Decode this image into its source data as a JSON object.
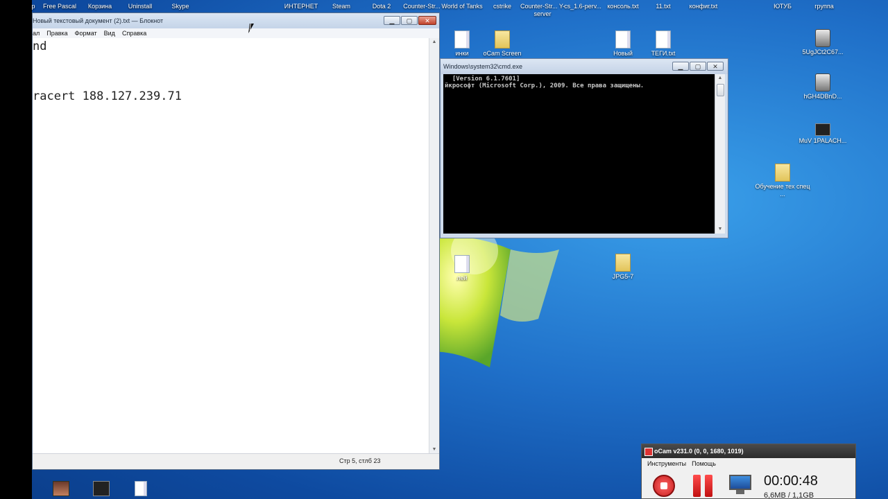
{
  "desktop": {
    "icons_top": [
      {
        "label": "р",
        "kind": "app"
      },
      {
        "label": "Free Pascal",
        "kind": "app"
      },
      {
        "label": "Корзина",
        "kind": "app"
      },
      {
        "label": "Uninstall",
        "kind": "app"
      },
      {
        "label": "Skype",
        "kind": "app"
      },
      {
        "label": "ИНТЕРНЕТ",
        "kind": "app"
      },
      {
        "label": "Steam",
        "kind": "app"
      },
      {
        "label": "Dota 2",
        "kind": "app"
      },
      {
        "label": "Counter-Str...",
        "kind": "app"
      },
      {
        "label": "World of Tanks",
        "kind": "app"
      },
      {
        "label": "cstrike",
        "kind": "folder"
      },
      {
        "label": "Counter-Str... Y-server",
        "kind": "app"
      },
      {
        "label": "cs_1.6-perv...",
        "kind": "doc"
      },
      {
        "label": "консоль.txt",
        "kind": "doc"
      },
      {
        "label": "11.txt",
        "kind": "doc"
      },
      {
        "label": "конфиг.txt",
        "kind": "doc"
      },
      {
        "label": "ЮТУБ",
        "kind": "app"
      },
      {
        "label": "группа",
        "kind": "app"
      }
    ],
    "icons_other": [
      {
        "label": "инки",
        "kind": "doc"
      },
      {
        "label": "oCam Screen",
        "kind": "folder"
      },
      {
        "label": "Новый",
        "kind": "doc"
      },
      {
        "label": "ТЕГИ.txt",
        "kind": "doc"
      },
      {
        "label": "5UgJCt2C67...",
        "kind": "app"
      },
      {
        "label": "hGH4DBnD...",
        "kind": "app"
      },
      {
        "label": "MuV 1PALACH...",
        "kind": "dark"
      },
      {
        "label": "Обучение тех спец ...",
        "kind": "folder"
      },
      {
        "label": "лей",
        "kind": "doc"
      },
      {
        "label": "JPG5-7",
        "kind": "folder"
      }
    ]
  },
  "notepad": {
    "title": "Новый текстовый документ (2).txt — Блокнот",
    "menu": [
      "ал",
      "Правка",
      "Формат",
      "Вид",
      "Справка"
    ],
    "lines": [
      "nd",
      "racert 188.127.239.71"
    ],
    "status": "Стр 5, стлб 23",
    "btn_min": "▁",
    "btn_max": "▢",
    "btn_close": "✕"
  },
  "cmd": {
    "title": "Windows\\system32\\cmd.exe",
    "lines": [
      "  [Version 6.1.7601]",
      "йкрософт (Microsoft Corp.), 2009. Все права защищены."
    ],
    "btn_min": "▁",
    "btn_max": "▢",
    "btn_close": "✕"
  },
  "ocam": {
    "title": "oCam v231.0 (0, 0, 1680, 1019)",
    "menu": [
      "Инструменты",
      "Помощь"
    ],
    "timer": "00:00:48",
    "size": "6,6MB / 1,1GB"
  }
}
